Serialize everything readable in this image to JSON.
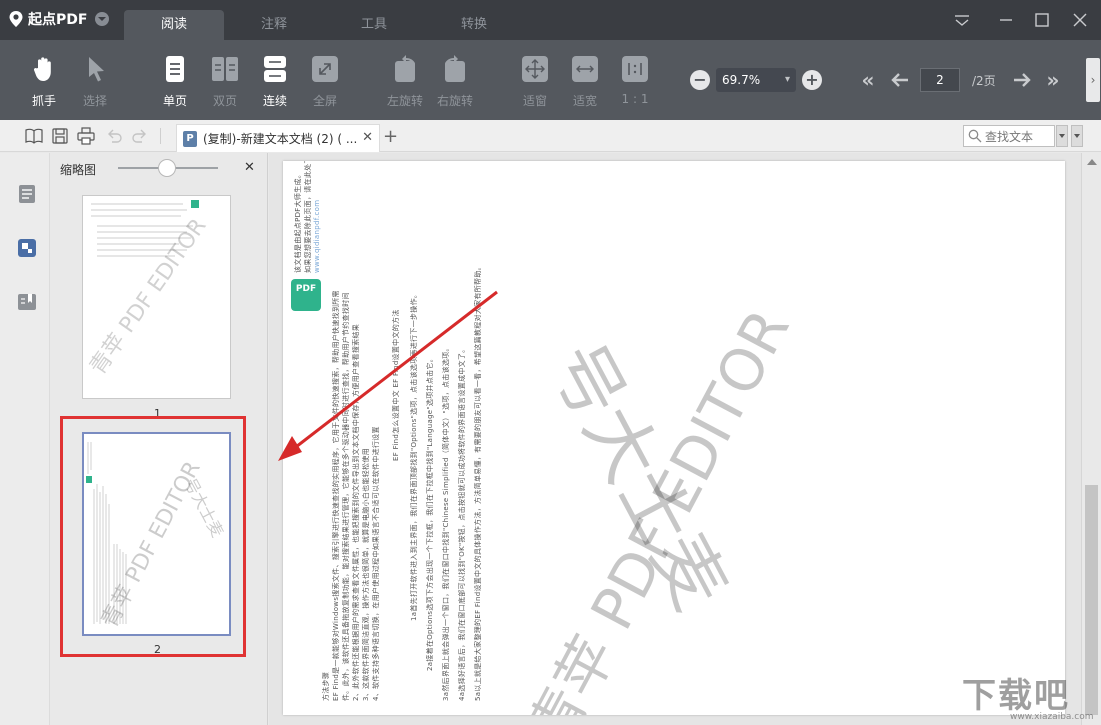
{
  "app": {
    "name": "起点PDF",
    "tabs": [
      "阅读",
      "注释",
      "工具",
      "转换"
    ],
    "active_tab": "阅读"
  },
  "toolbar": {
    "hand": "抓手",
    "select": "选择",
    "single_page": "单页",
    "double_page": "双页",
    "continuous": "连续",
    "fullscreen": "全屏",
    "rotate_left": "左旋转",
    "rotate_right": "右旋转",
    "fit_window": "适窗",
    "fit_width": "适宽",
    "actual_size": "1 : 1",
    "zoom_value": "69.7%",
    "page_current": "2",
    "page_total": "/2页"
  },
  "docbar": {
    "tab_title": "(复制)-新建文本文档 (2) ( ...",
    "search_placeholder": "查找文本"
  },
  "thumbnails": {
    "header": "缩略图",
    "pages": [
      "1",
      "2"
    ]
  },
  "page": {
    "header_lines": [
      "该文档是由起点PDF大师生成。",
      "如果您想要去除此页面，请在此处下载：",
      "www.qidianpdf.com"
    ],
    "pdf_badge": "PDF",
    "body_lines": [
      "EF Find是一款能够对Windows搜索文件、搜索引擎进行快速查找的实用程序，它用于文件的快速搜索，帮助用户快速找到所需",
      "件。此外，该软件还具备拖放复制功能，能对搜索结果进行管理，它能够在多个驱动器中同时进行查找，帮助用户节约查找时间",
      "2、此外软件还能根据用户的需求查看文件属性，也能把搜索到的文件导出到文本文档中保存，方便用户查看搜索结果",
      "3、这款软件界面简洁直观，操作方法也很简单，就算是电脑小白也能轻松使用",
      "4、软件支持多种语言切换，在用户使用过程中如果语言不合适可以在软件中进行设置",
      "EF Find怎么设置中文 EF Find设置中文的方法",
      "1a首先打开软件进入到主界面，我们在界面顶部找到\"Options\"选项，点击该选项再进行下一步操作。",
      "2a接着在Options选项下方会出现一个下拉框，我们在下拉框中找到\"Language\"选项并点击它。",
      "3a然后界面上就会弹出一个窗口，我们在窗口中找到\"Chinese Simplified（简体中文）\"选项，点击该选项。",
      "4a选择好语言后，我们在窗口底部可以找到\"OK\"按钮，点击按钮就可以成功将软件的界面语言设置成中文了。",
      "5a以上就是给大家整理的EF Find设置中文的具体操作方法，方法简单易懂，有需要的朋友可以看一看，希望这篇教程对大家有所帮助。",
      "方法步骤"
    ],
    "watermark_line1": "青苹 PDF EDITOR",
    "watermark_line2": "号大士麦"
  },
  "site_watermark": {
    "logo": "下载吧",
    "url": "www.xiazaiba.com"
  }
}
